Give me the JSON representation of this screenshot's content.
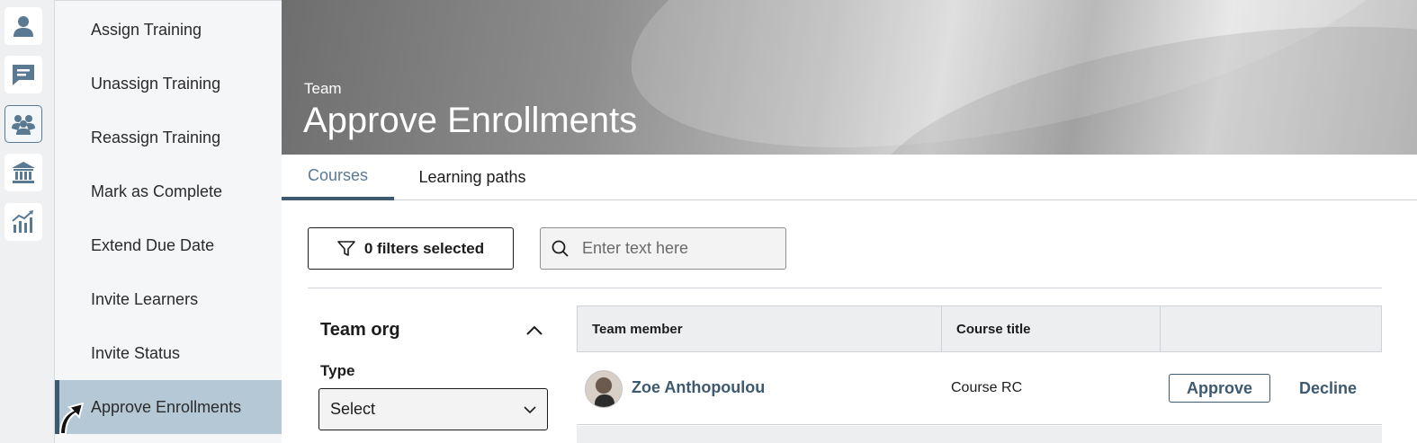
{
  "rail": {
    "items": [
      {
        "icon": "user-icon",
        "active": false
      },
      {
        "icon": "chat-icon",
        "active": false
      },
      {
        "icon": "team-icon",
        "active": true
      },
      {
        "icon": "institution-icon",
        "active": false
      },
      {
        "icon": "analytics-icon",
        "active": false
      }
    ]
  },
  "menu": {
    "items": [
      {
        "label": "Assign Training"
      },
      {
        "label": "Unassign Training"
      },
      {
        "label": "Reassign Training"
      },
      {
        "label": "Mark as Complete"
      },
      {
        "label": "Extend Due Date"
      },
      {
        "label": "Invite Learners"
      },
      {
        "label": "Invite Status"
      },
      {
        "label": "Approve Enrollments",
        "active": true
      }
    ]
  },
  "header": {
    "subtitle": "Team",
    "title": "Approve Enrollments"
  },
  "tabs": [
    {
      "label": "Courses",
      "active": true
    },
    {
      "label": "Learning paths",
      "active": false
    }
  ],
  "toolbar": {
    "filter_label": "0 filters selected",
    "search_placeholder": "Enter text here"
  },
  "filters": {
    "section_title": "Team org",
    "type_label": "Type",
    "type_value": "Select"
  },
  "table": {
    "columns": [
      "Team member",
      "Course title",
      ""
    ],
    "rows": [
      {
        "member": "Zoe Anthopoulou",
        "course": "Course RC",
        "approve_label": "Approve",
        "decline_label": "Decline"
      }
    ]
  },
  "colors": {
    "accent": "#3d5a70",
    "accent_light": "#5a7a93",
    "menu_active_bg": "#b5c8d6"
  }
}
